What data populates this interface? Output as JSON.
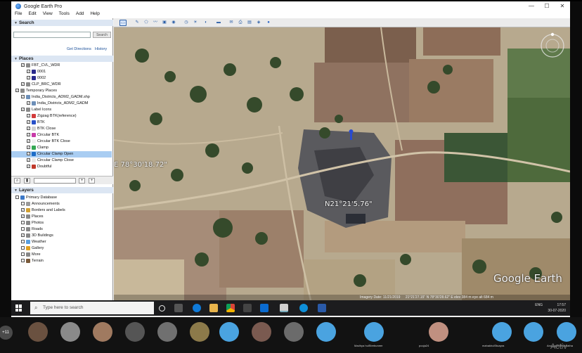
{
  "window": {
    "title": "Google Earth Pro",
    "controls": [
      "—",
      "☐",
      "✕"
    ]
  },
  "menu": [
    "File",
    "Edit",
    "View",
    "Tools",
    "Add",
    "Help"
  ],
  "search": {
    "header": "Search",
    "button": "Search",
    "get_directions": "Get Directions",
    "history": "History"
  },
  "places": {
    "header": "Places",
    "items": [
      {
        "label": "FBT_CVL_WDR",
        "indent": 1,
        "icon": "folder-icon",
        "color": "#8a8a8a"
      },
      {
        "label": "0001",
        "indent": 2,
        "icon": "placemark-icon",
        "color": "#2a2a8c"
      },
      {
        "label": "0002",
        "indent": 2,
        "icon": "placemark-icon",
        "color": "#2a2a8c"
      },
      {
        "label": "CLP_BRC_WDR",
        "indent": 1,
        "icon": "folder-icon",
        "color": "#8a8a8a"
      },
      {
        "label": "Temporary Places",
        "indent": 0,
        "icon": "folder-icon",
        "color": "#8a8a8a"
      },
      {
        "label": "India_Districts_ADM2_GADM.shp",
        "indent": 1,
        "icon": "layer-icon",
        "color": "#6d8fb8"
      },
      {
        "label": "India_Districts_ADM2_GADM",
        "indent": 2,
        "icon": "layer-icon",
        "color": "#6d8fb8"
      },
      {
        "label": "Label Icons",
        "indent": 1,
        "icon": "folder-icon",
        "color": "#8a8a8a"
      },
      {
        "label": "Zigzag BTK(reference)",
        "indent": 2,
        "icon": "placemark-icon",
        "color": "#d23a3a"
      },
      {
        "label": "BTK",
        "indent": 2,
        "icon": "placemark-icon",
        "color": "#2850c8"
      },
      {
        "label": "BTK Close",
        "indent": 2,
        "icon": "placemark-icon",
        "color": "#d2d2d2"
      },
      {
        "label": "Circular BTK",
        "indent": 2,
        "icon": "placemark-icon",
        "color": "#c83aa8"
      },
      {
        "label": "Circular BTK Close",
        "indent": 2,
        "icon": "placemark-icon",
        "color": "#f1f1f1"
      },
      {
        "label": "Clamp",
        "indent": 2,
        "icon": "placemark-icon",
        "color": "#34a853"
      },
      {
        "label": "Circular Clamp Open",
        "indent": 2,
        "icon": "placemark-icon",
        "color": "#1c6cc8",
        "selected": true
      },
      {
        "label": "Circular Clamp Close",
        "indent": 2,
        "icon": "placemark-icon",
        "color": "#e8e8e8"
      },
      {
        "label": "Doubtful",
        "indent": 2,
        "icon": "placemark-icon",
        "color": "#c0392b"
      }
    ]
  },
  "layers": {
    "header": "Layers",
    "items": [
      {
        "label": "Primary Database",
        "icon": "globe-icon",
        "color": "#3b78c8"
      },
      {
        "label": "Announcements",
        "icon": "doc-icon",
        "color": "#9a9a9a"
      },
      {
        "label": "Borders and Labels",
        "icon": "borders-icon",
        "color": "#d2a030"
      },
      {
        "label": "Places",
        "icon": "places-icon",
        "color": "#888"
      },
      {
        "label": "Photos",
        "icon": "photo-icon",
        "color": "#888"
      },
      {
        "label": "Roads",
        "icon": "roads-icon",
        "color": "#888"
      },
      {
        "label": "3D Buildings",
        "icon": "building-icon",
        "color": "#888"
      },
      {
        "label": "Weather",
        "icon": "weather-icon",
        "color": "#5aa0e0"
      },
      {
        "label": "Gallery",
        "icon": "gallery-icon",
        "color": "#e0a020"
      },
      {
        "label": "More",
        "icon": "more-icon",
        "color": "#888"
      },
      {
        "label": "Terrain",
        "icon": "terrain-icon",
        "color": "#7a5a3a"
      }
    ]
  },
  "map": {
    "latitude_label": "N21°21'5.76\"",
    "longitude_label": "E 78°30'18.72\"",
    "watermark": "Google Earth",
    "image_date": "Imagery Date: 11/21/2019",
    "coords_status": "21°21'27.15\" N  78°30'28.62\" E  elev 384 m  eye alt 684 m"
  },
  "taskbar": {
    "search_placeholder": "Type here to search",
    "clock_time": "17:57",
    "clock_date": "30-07-2020",
    "lang": "ENG"
  },
  "participants": {
    "more_count": "+11",
    "names": [
      "",
      "",
      "",
      "",
      "",
      "",
      "",
      "",
      "",
      "",
      "Madhya hulStrebuneer",
      "pooja24",
      "mahakhulStuapra",
      "",
      "Anuragkhuthushatha"
    ]
  },
  "watermark_overlay": "Activ"
}
